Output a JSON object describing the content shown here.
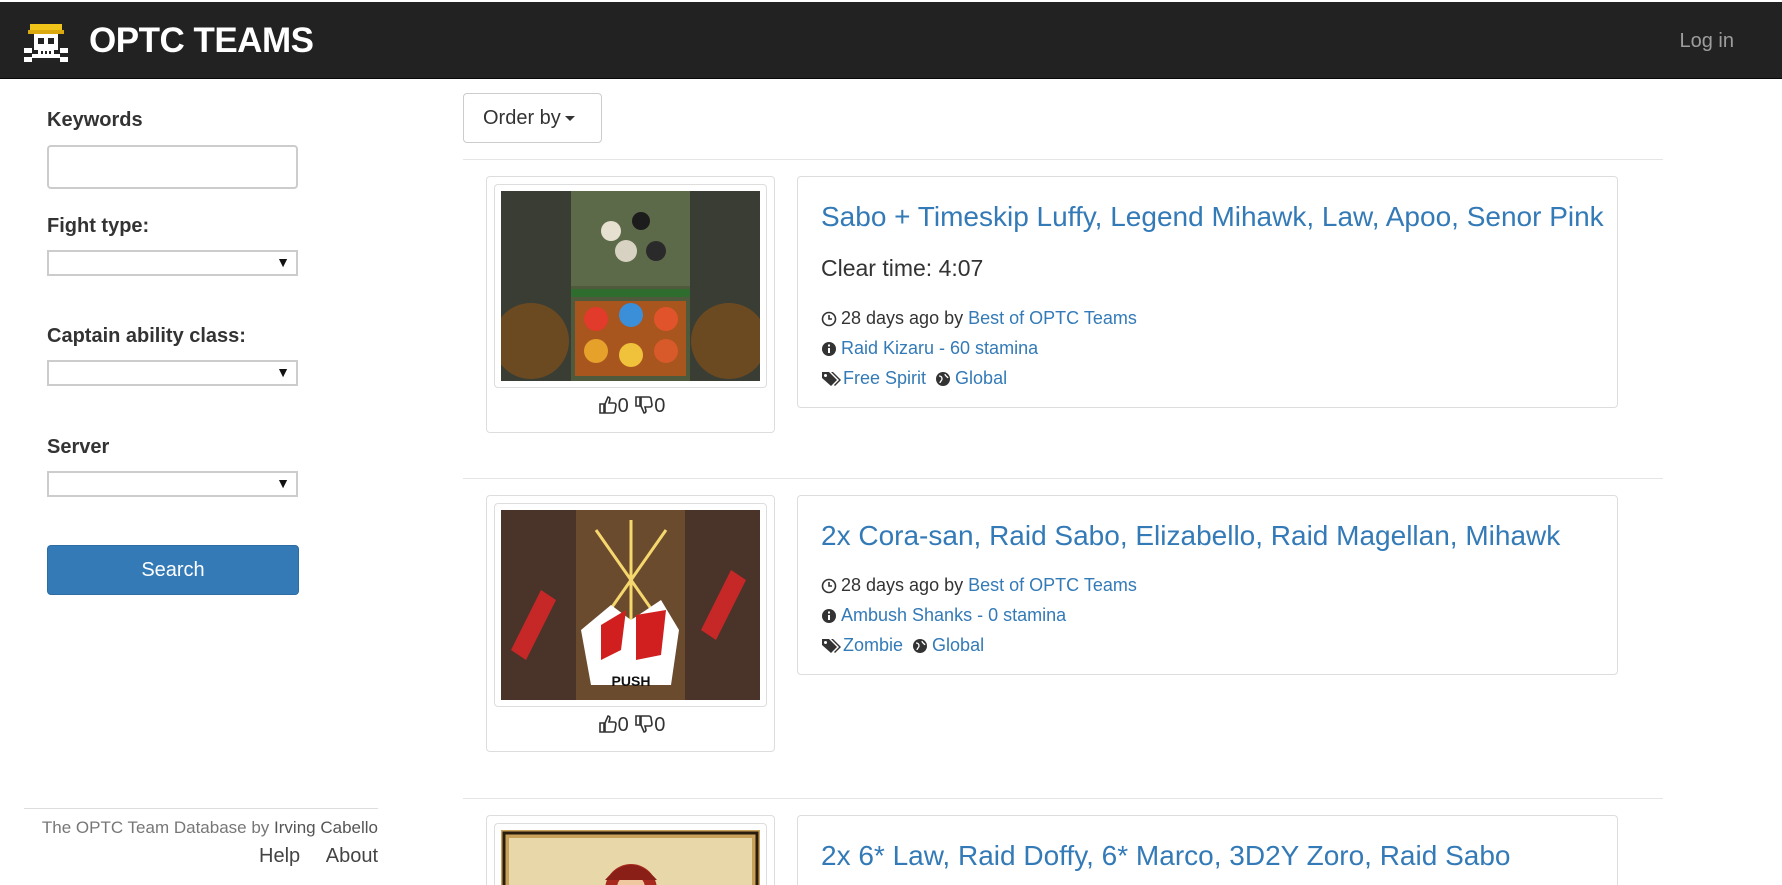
{
  "header": {
    "brand": "OPTC TEAMS",
    "login": "Log in"
  },
  "sidebar": {
    "keywords_label": "Keywords",
    "keywords_value": "",
    "fight_type_label": "Fight type:",
    "captain_label": "Captain ability class:",
    "server_label": "Server",
    "search_button": "Search",
    "footer": {
      "credit_prefix": "The OPTC Team Database by",
      "author": "Irving Cabello",
      "help": "Help",
      "about": "About"
    }
  },
  "main": {
    "order_by": "Order by",
    "teams": [
      {
        "title": "Sabo + Timeskip Luffy, Legend Mihawk, Law, Apoo, Senor Pink",
        "clear_time": "Clear time: 4:07",
        "time_ago": "28 days ago by",
        "author": "Best of OPTC Teams",
        "stage": "Raid Kizaru - 60 stamina",
        "tag": "Free Spirit",
        "server": "Global",
        "likes": "0",
        "dislikes": "0"
      },
      {
        "title": "2x Cora-san, Raid Sabo, Elizabello, Raid Magellan, Mihawk",
        "time_ago": "28 days ago by",
        "author": "Best of OPTC Teams",
        "stage": "Ambush Shanks - 0 stamina",
        "tag": "Zombie",
        "server": "Global",
        "likes": "0",
        "dislikes": "0",
        "image_text": "PUSH"
      },
      {
        "title": "2x 6* Law, Raid Doffy, 6* Marco, 3D2Y Zoro, Raid Sabo"
      }
    ]
  },
  "colors": {
    "navbar": "#222222",
    "link": "#337ab7",
    "primary_button": "#337ab7"
  },
  "icons": [
    "skull-logo-icon",
    "caret-down-icon",
    "thumbs-up-icon",
    "thumbs-down-icon",
    "clock-icon",
    "info-icon",
    "tags-icon",
    "globe-icon"
  ]
}
